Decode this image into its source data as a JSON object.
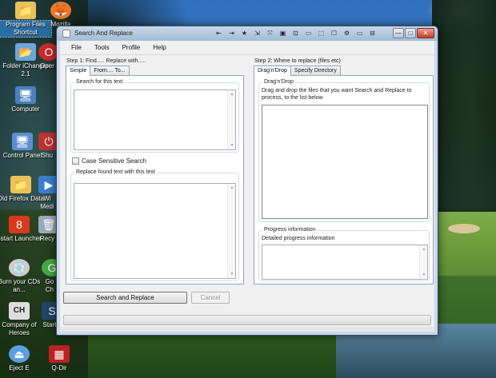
{
  "desktop": {
    "icons": [
      {
        "label": "Program Files Shortcut",
        "glyph": "📁"
      },
      {
        "label": "Mozilla",
        "glyph": "🦊"
      },
      {
        "label": "Folder iChanger 2.1",
        "glyph": "📂"
      },
      {
        "label": "Oper",
        "glyph": "O"
      },
      {
        "label": "Computer",
        "glyph": "🖥"
      },
      {
        "label": "Control Panel",
        "glyph": "🖥"
      },
      {
        "label": "Shu",
        "glyph": "⏻"
      },
      {
        "label": "Old Firefox Data",
        "glyph": "📁"
      },
      {
        "label": "Wi Medi",
        "glyph": "▶"
      },
      {
        "label": "8start Launcher",
        "glyph": "8"
      },
      {
        "label": "Recy",
        "glyph": "🗑"
      },
      {
        "label": "Burn your CDs an...",
        "glyph": "💿"
      },
      {
        "label": "Go Ch",
        "glyph": "G"
      },
      {
        "label": "Company of Heroes",
        "glyph": "CH"
      },
      {
        "label": "Start",
        "glyph": "S"
      },
      {
        "label": "Eject E",
        "glyph": "⏏"
      },
      {
        "label": "Q-Dir",
        "glyph": "▦"
      }
    ]
  },
  "window": {
    "title": "Search And Replace",
    "toolbar_icons": [
      "⇤",
      "⇥",
      "★",
      "⇲",
      "⤧",
      "▣",
      "⊡",
      "▭",
      "⬚",
      "☐",
      "⚙",
      "▭",
      "⊟"
    ],
    "controls": {
      "minimize": "—",
      "maximize": "□",
      "close": "✕"
    },
    "menu": [
      "File",
      "Tools",
      "Profile",
      "Help"
    ]
  },
  "step1": {
    "label": "Step 1: Find..... Replace with.....",
    "tabs": [
      "Simple",
      "From.... To..."
    ],
    "search_group_title": "Search for this text",
    "search_text": "",
    "case_sensitive_label": "Case Sensitive Search",
    "replace_group_title": "Replace found text with this text",
    "replace_text": ""
  },
  "step2": {
    "label": "Step 2: Where to replace (files etc)",
    "tabs": [
      "Drag'n'Drop",
      "Specify Directory"
    ],
    "drag_group_title": "Drag'n'Drop",
    "drag_description": "Drag and drop the files that you want Search and Replace to process, to the list below",
    "progress_group_title": "Progress information",
    "progress_description": "Detailed progress information"
  },
  "buttons": {
    "search_replace": "Search and Replace",
    "cancel": "Cancel"
  },
  "scroll_arrows": {
    "up": "▲",
    "down": "▼"
  }
}
